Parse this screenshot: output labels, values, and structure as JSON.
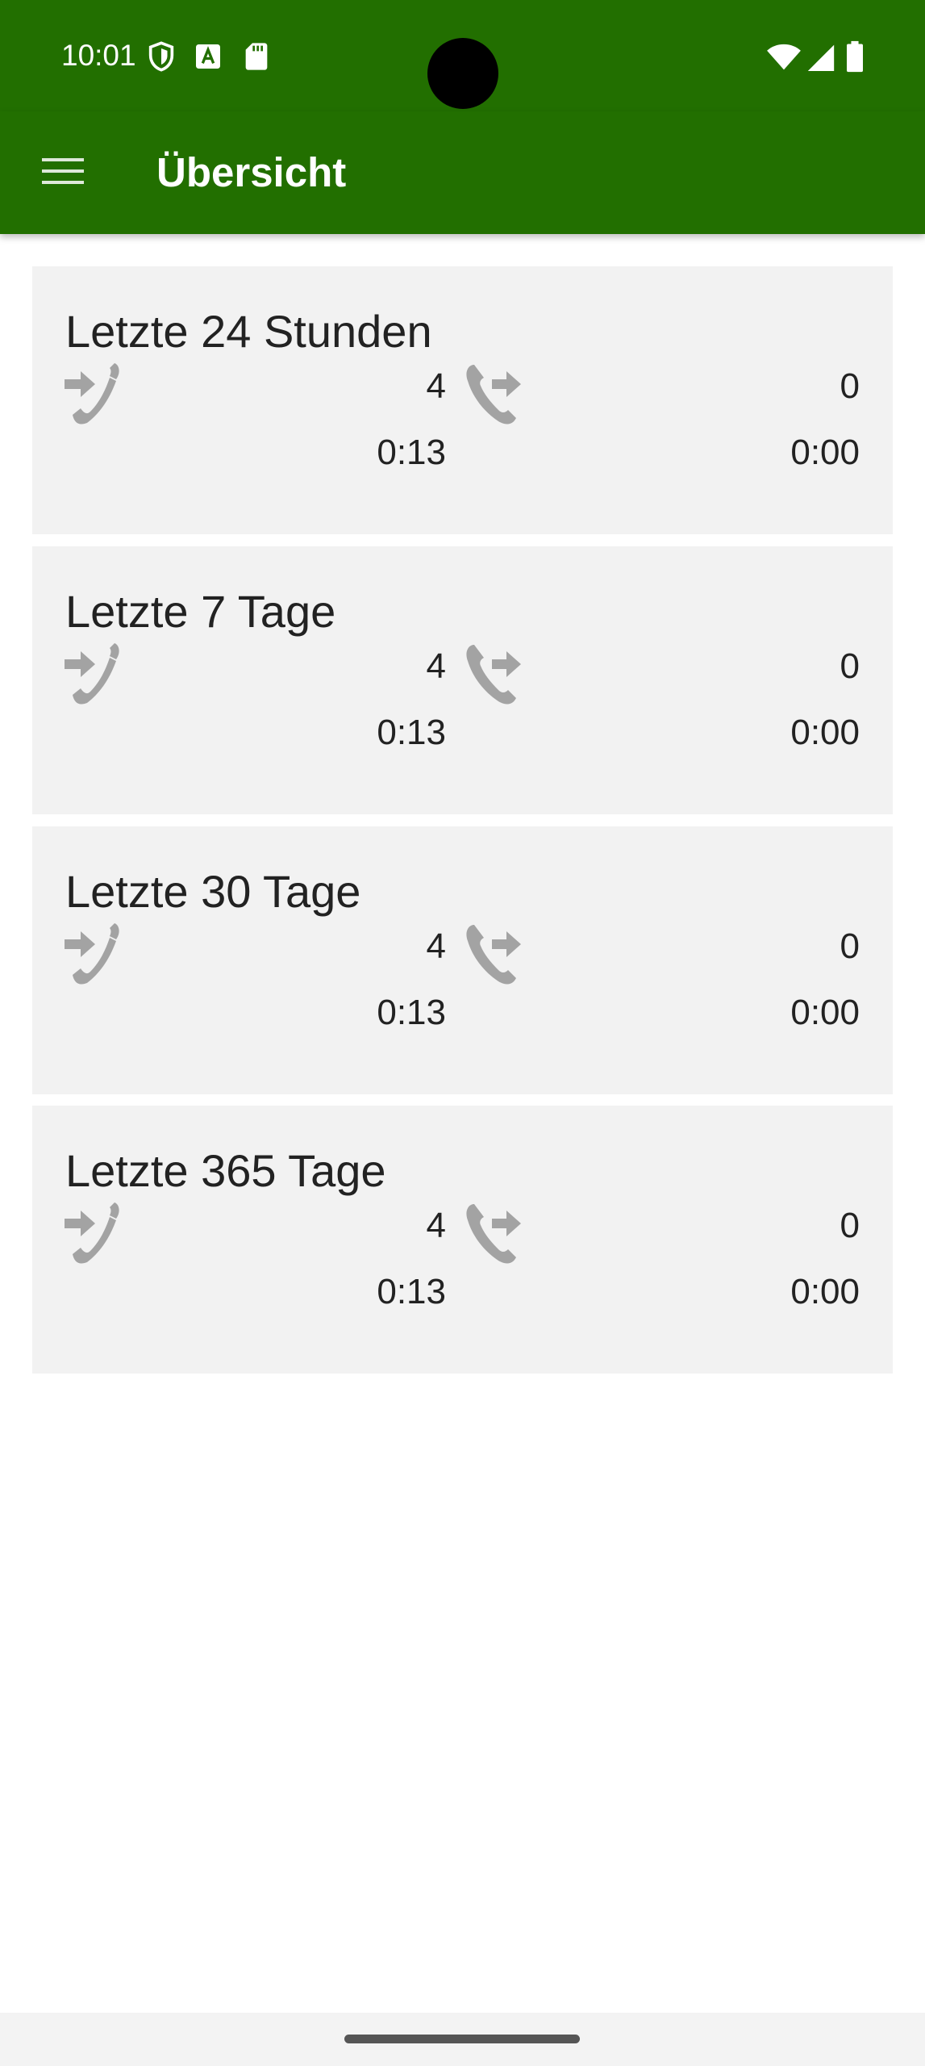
{
  "status_bar": {
    "time": "10:01",
    "icons_left": [
      "shield-icon",
      "font-icon",
      "sd-card-icon"
    ],
    "icons_right": [
      "wifi-icon",
      "signal-icon",
      "battery-icon"
    ]
  },
  "app_bar": {
    "title": "Übersicht",
    "menu_icon": "hamburger-menu-icon",
    "color": "#226f00"
  },
  "cards": [
    {
      "title": "Letzte 24 Stunden",
      "incoming": {
        "count": "4",
        "duration": "0:13"
      },
      "outgoing": {
        "count": "0",
        "duration": "0:00"
      }
    },
    {
      "title": "Letzte 7 Tage",
      "incoming": {
        "count": "4",
        "duration": "0:13"
      },
      "outgoing": {
        "count": "0",
        "duration": "0:00"
      }
    },
    {
      "title": "Letzte 30 Tage",
      "incoming": {
        "count": "4",
        "duration": "0:13"
      },
      "outgoing": {
        "count": "0",
        "duration": "0:00"
      }
    },
    {
      "title": "Letzte 365 Tage",
      "incoming": {
        "count": "4",
        "duration": "0:13"
      },
      "outgoing": {
        "count": "0",
        "duration": "0:00"
      }
    }
  ],
  "icons": {
    "incoming": "incoming-call-icon",
    "outgoing": "outgoing-call-icon"
  }
}
